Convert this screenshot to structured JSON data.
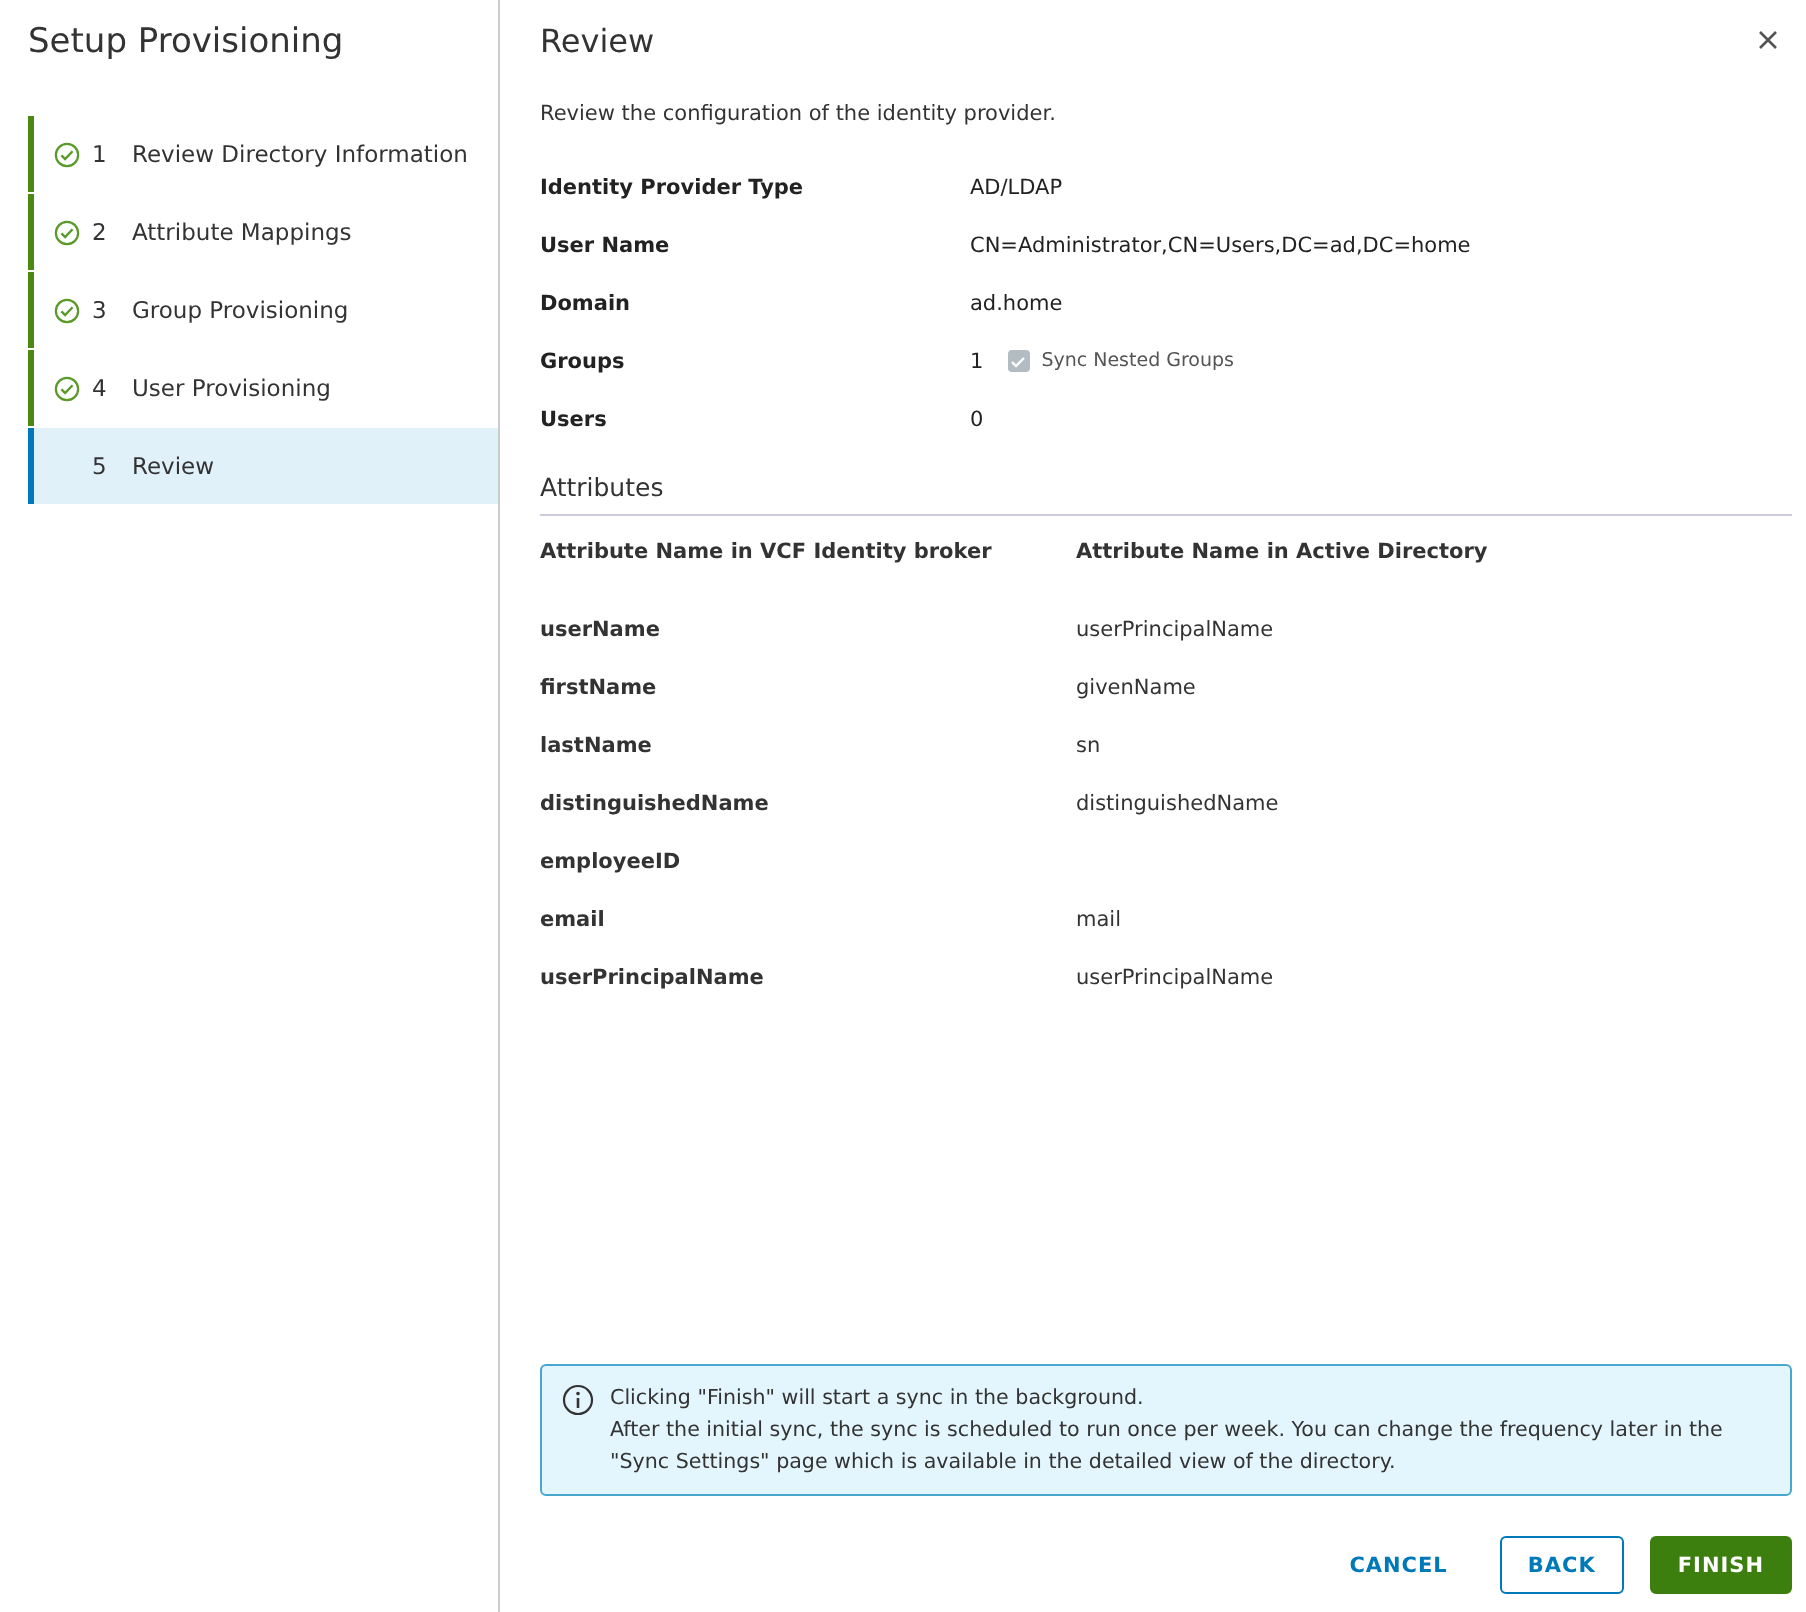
{
  "sidebar": {
    "title": "Setup Provisioning",
    "steps": [
      {
        "number": "1",
        "label": "Review Directory Information",
        "completed": true,
        "selected": false
      },
      {
        "number": "2",
        "label": "Attribute Mappings",
        "completed": true,
        "selected": false
      },
      {
        "number": "3",
        "label": "Group Provisioning",
        "completed": true,
        "selected": false
      },
      {
        "number": "4",
        "label": "User Provisioning",
        "completed": true,
        "selected": false
      },
      {
        "number": "5",
        "label": "Review",
        "completed": false,
        "selected": true
      }
    ]
  },
  "main": {
    "title": "Review",
    "description": "Review the configuration of the identity provider.",
    "summary": [
      {
        "label": "Identity Provider Type",
        "value": "AD/LDAP"
      },
      {
        "label": "User Name",
        "value": "CN=Administrator,CN=Users,DC=ad,DC=home"
      },
      {
        "label": "Domain",
        "value": "ad.home"
      },
      {
        "label": "Groups",
        "value": "1",
        "checkbox": {
          "label": "Sync Nested Groups",
          "checked": true,
          "disabled": true
        }
      },
      {
        "label": "Users",
        "value": "0"
      }
    ],
    "attributes": {
      "heading": "Attributes",
      "columns": [
        "Attribute Name in VCF Identity broker",
        "Attribute Name in Active Directory"
      ],
      "rows": [
        [
          "userName",
          "userPrincipalName"
        ],
        [
          "firstName",
          "givenName"
        ],
        [
          "lastName",
          "sn"
        ],
        [
          "distinguishedName",
          "distinguishedName"
        ],
        [
          "employeeID",
          ""
        ],
        [
          "email",
          "mail"
        ],
        [
          "userPrincipalName",
          "userPrincipalName"
        ]
      ]
    },
    "info": [
      "Clicking \"Finish\" will start a sync in the background.",
      "After the initial sync, the sync is scheduled to run once per week. You can change the frequency later in the \"Sync Settings\" page which is available in the detailed view of the directory."
    ],
    "buttons": [
      {
        "label": "CANCEL",
        "kind": "flat"
      },
      {
        "label": "BACK",
        "kind": "outline"
      },
      {
        "label": "FINISH",
        "kind": "primary"
      }
    ]
  }
}
